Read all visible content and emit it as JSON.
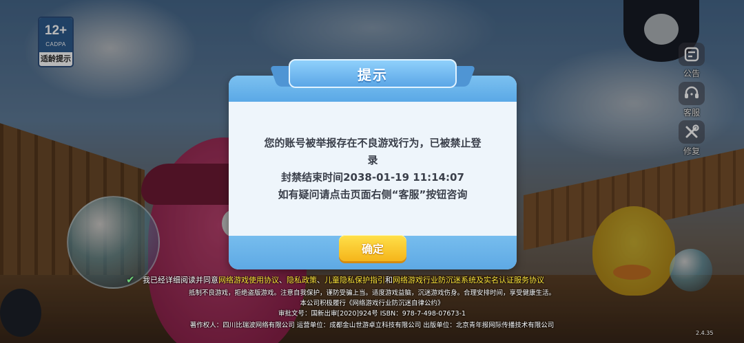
{
  "age_badge": {
    "rating": "12+",
    "org": "CADPA",
    "label": "适龄提示"
  },
  "side_buttons": [
    {
      "label": "公告",
      "icon": "announcement-icon"
    },
    {
      "label": "客服",
      "icon": "headset-icon"
    },
    {
      "label": "修复",
      "icon": "wrench-screwdriver-icon"
    }
  ],
  "dialog": {
    "title": "提示",
    "message_lines": [
      "您的账号被举报存在不良游戏行为，已被禁止登",
      "录",
      "封禁结束时间2038-01-19 11:14:07",
      "如有疑问请点击页面右侧“客服”按钮咨询"
    ],
    "confirm_label": "确定"
  },
  "agreement": {
    "prefix": "我已经详细阅读并同意",
    "link1": "网络游戏使用协议",
    "sep1": "、",
    "link2": "隐私政策",
    "sep2": "、",
    "link3": "儿童隐私保护指引",
    "sep3": "和",
    "link4": "网络游戏行业防沉迷系统及实名认证服务协议"
  },
  "legal_lines": [
    "抵制不良游戏，拒绝盗版游戏。注意自我保护，谨防受骗上当。适度游戏益脑，沉迷游戏伤身。合理安排时间，享受健康生活。",
    "本公司积极履行《网络游戏行业防沉迷自律公约》",
    "审批文号：国新出审[2020]924号  ISBN：978-7-498-07673-1",
    "著作权人：四川比瑞波网络有限公司   运营单位：成都金山世游卓立科技有限公司   出版单位：北京青年报网际传播技术有限公司"
  ],
  "version": "2.4.35",
  "colors": {
    "dialog_blue": "#5aa8e6",
    "confirm_yellow": "#f5b51a",
    "link_yellow": "#ffe53a"
  }
}
